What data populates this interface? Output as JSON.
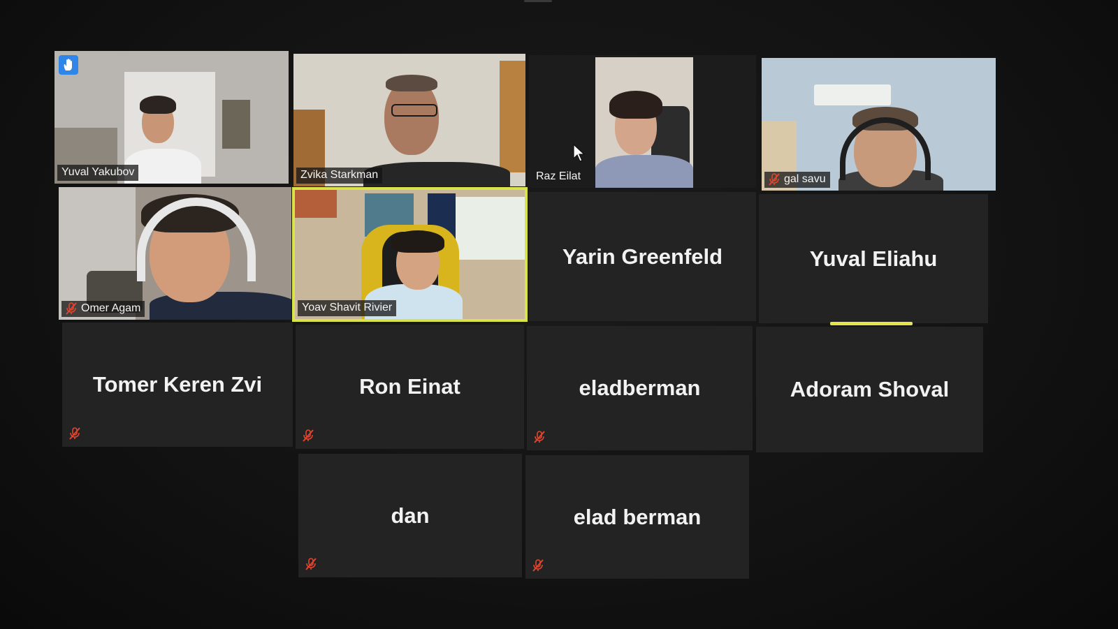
{
  "participants": {
    "yuval_yakubov": {
      "name": "Yuval Yakubov",
      "muted": false,
      "hand_raised": true
    },
    "zvika_starkman": {
      "name": "Zvika Starkman",
      "muted": false
    },
    "raz_eilat": {
      "name": "Raz Eilat",
      "muted": false
    },
    "gal_savu": {
      "name": "gal savu",
      "muted": true
    },
    "omer_agam": {
      "name": "Omer Agam",
      "muted": true
    },
    "yoav_shavit_rivier": {
      "name": "Yoav Shavit Rivier",
      "muted": false,
      "active_speaker": true
    },
    "yarin_greenfeld": {
      "name": "Yarin Greenfeld",
      "muted": false
    },
    "yuval_eliahu": {
      "name": "Yuval Eliahu",
      "muted": false,
      "speaking": true
    },
    "tomer_keren_zvi": {
      "name": "Tomer Keren Zvi",
      "muted": true
    },
    "ron_einat": {
      "name": "Ron Einat",
      "muted": true
    },
    "eladberman": {
      "name": "eladberman",
      "muted": true
    },
    "adoram_shoval": {
      "name": "Adoram Shoval",
      "muted": false
    },
    "dan": {
      "name": "dan",
      "muted": true
    },
    "elad_berman": {
      "name": "elad berman",
      "muted": true
    }
  },
  "colors": {
    "active_speaker_border": "#d9e34a",
    "speaking_bar": "#e6e54a",
    "mute_icon": "#e2452e",
    "raise_hand_badge": "#2f86e8",
    "tile_background": "#232323"
  },
  "icons": {
    "mute": "microphone-muted-icon",
    "hand": "raise-hand-icon",
    "cursor": "mouse-pointer-icon"
  }
}
